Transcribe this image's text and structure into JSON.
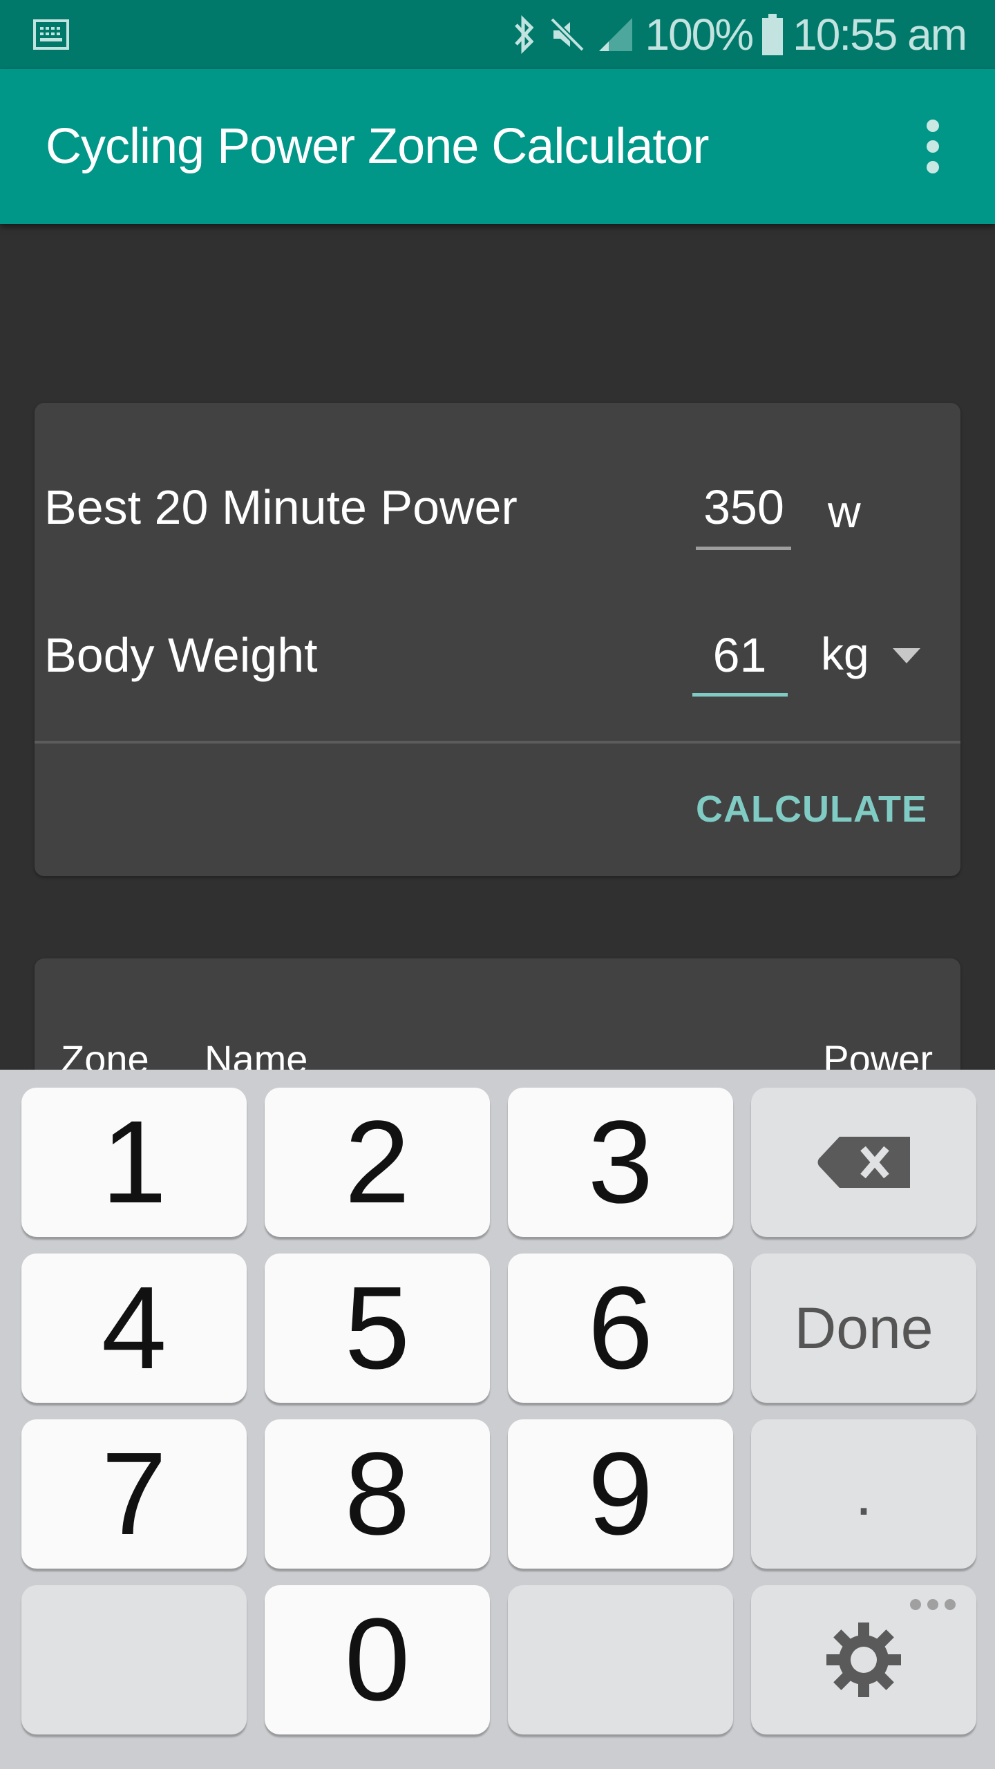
{
  "status_bar": {
    "battery_percent": "100%",
    "time": "10:55 am",
    "icons": [
      "keyboard-icon",
      "bluetooth-icon",
      "mute-icon",
      "signal-icon",
      "battery-icon"
    ]
  },
  "app_bar": {
    "title": "Cycling Power Zone Calculator",
    "overflow_icon": "more-vert-icon"
  },
  "input_card": {
    "power": {
      "label": "Best 20 Minute Power",
      "value": "350",
      "unit": "w"
    },
    "weight": {
      "label": "Body Weight",
      "value": "61",
      "unit": "kg",
      "unit_dropdown_icon": "dropdown-arrow-icon"
    },
    "calculate_label": "CALCULATE"
  },
  "results_card": {
    "columns": [
      "Zone",
      "Name",
      "Power"
    ]
  },
  "keyboard": {
    "rows": [
      [
        "1",
        "2",
        "3",
        "backspace"
      ],
      [
        "4",
        "5",
        "6",
        "Done"
      ],
      [
        "7",
        "8",
        "9",
        "."
      ],
      [
        "",
        "0",
        "",
        "settings"
      ]
    ],
    "done_label": "Done",
    "dot_label": "."
  },
  "colors": {
    "status_bar": "#00796b",
    "app_bar": "#009688",
    "accent": "#80cbc4",
    "background": "#303030",
    "card": "#424242",
    "keyboard_bg": "#cbcdd0"
  }
}
